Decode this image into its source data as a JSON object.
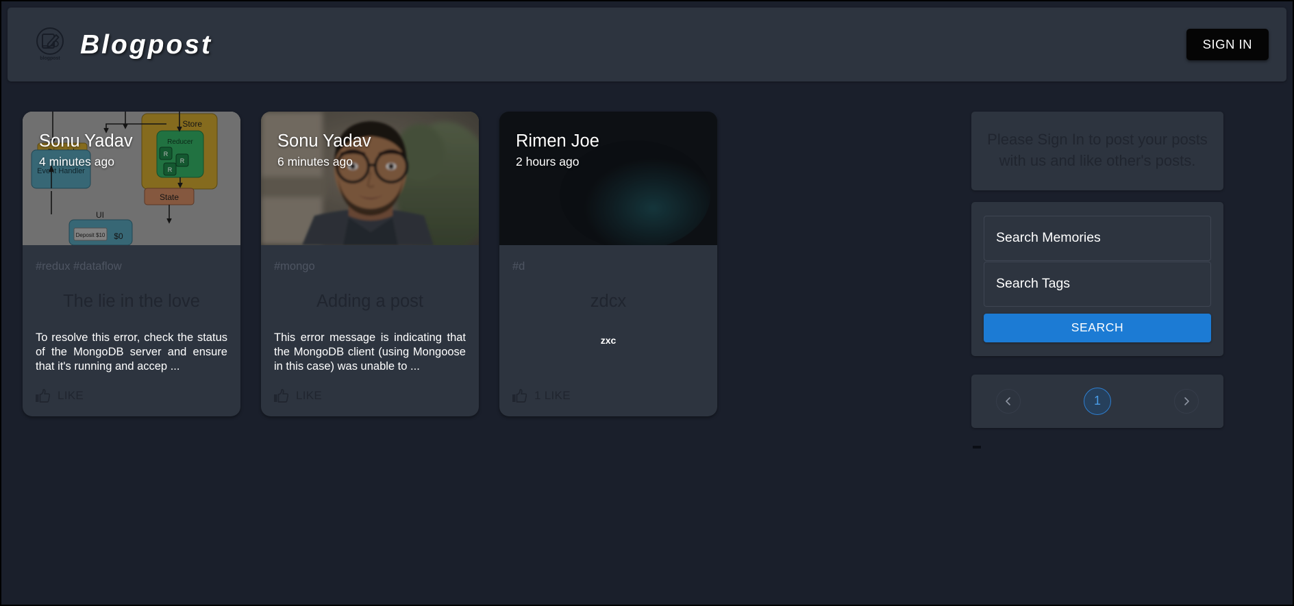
{
  "header": {
    "logo_icon": "blogpost-notebook-pen-icon",
    "logo_caption": "blogpost",
    "title": "Blogpost",
    "signin_label": "SIGN IN"
  },
  "colors": {
    "page_background": "#1a1f2b",
    "surface": "#2d343f",
    "accent_blue": "#1c7bd4",
    "pagination_active": "#4a9de8",
    "signin_button": "#050505",
    "muted_text": "#4e5562",
    "dark_text": "#20252f"
  },
  "posts": [
    {
      "author": "Sonu Yadav",
      "time": "4 minutes ago",
      "tags": "#redux #dataflow",
      "title": "The lie in the love",
      "message": "To resolve this error, check the status of the MongoDB server and ensure that it's running and accep ...",
      "like_label": "LIKE",
      "like_count": "",
      "like_icon": "thumbs-up-icon",
      "media": "redux-dataflow-diagram"
    },
    {
      "author": "Sonu Yadav",
      "time": "6 minutes ago",
      "tags": "#mongo",
      "title": "Adding a post",
      "message": "This error message is indicating that the MongoDB client (using Mongoose in this case) was unable to ...",
      "like_label": "LIKE",
      "like_count": "",
      "like_icon": "thumbs-up-icon",
      "media": "portrait-photo"
    },
    {
      "author": "Rimen Joe",
      "time": "2 hours ago",
      "tags": "#d",
      "title": "zdcx",
      "message": "zxc",
      "like_label": "1 LIKE",
      "like_count": "1",
      "like_icon": "thumbs-up-icon",
      "media": "dark-teal-glow"
    }
  ],
  "sidebar": {
    "signin_notice": "Please Sign In to post your posts with us and like other's posts.",
    "search": {
      "memories_placeholder": "Search Memories",
      "memories_value": "",
      "tags_placeholder": "Search Tags",
      "tags_value": "",
      "button_label": "SEARCH"
    },
    "pagination": {
      "prev_icon": "chevron-left-icon",
      "next_icon": "chevron-right-icon",
      "current_page": "1"
    }
  }
}
